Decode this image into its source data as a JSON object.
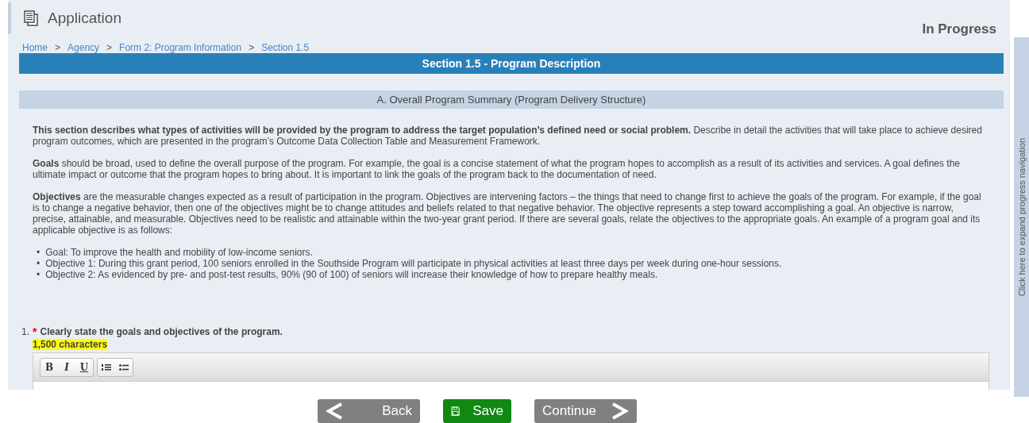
{
  "header": {
    "title": "Application",
    "status": "In Progress"
  },
  "breadcrumbs": [
    "Home",
    "Agency",
    "Form 2: Program Information",
    "Section 1.5"
  ],
  "breadcrumb_separator": ">",
  "section_title": "Section 1.5 - Program Description",
  "subsection_title": "A. Overall Program Summary (Program Delivery Structure)",
  "paragraphs": [
    "**This section describes what types of activities will be provided by the program to address the target population’s defined need or social problem.** Describe in detail the activities that will take place to achieve desired program outcomes, which are presented in the program’s Outcome Data Collection Table and Measurement Framework.",
    "**Goals** should be broad, used to define the overall purpose of the program. For example, the goal is a concise statement of what the program hopes to accomplish as a result of its activities and services. A goal defines the ultimate impact or outcome that the program hopes to bring about. It is important to link the goals of the program back to the documentation of need.",
    "**Objectives** are the measurable changes expected as a result of participation in the program. Objectives are intervening factors – the things that need to change first to achieve the goals of the program. For example, if the goal is to change a negative behavior, then one of the objectives might be to change attitudes and beliefs related to that negative behavior. The objective represents a step toward accomplishing a goal. An objective is narrow, precise, attainable, and measurable. Objectives need to be realistic and attainable within the two-year grant period. If there are several goals, relate the objectives to the appropriate goals. An example of a program goal and its applicable objective is as follows:"
  ],
  "bullet_marker": "•",
  "bullets": [
    "Goal: To improve the health and mobility of low-income seniors.",
    "Objective 1: During this grant period, 100 seniors enrolled in the Southside Program will participate in physical activities at least three days per week during one-hour sessions.",
    "Objective 2: As evidenced by pre- and post-test results, 90% (90 of 100) of seniors will increase their knowledge of how to prepare healthy meals."
  ],
  "question": {
    "number": "1.",
    "required": true,
    "required_mark": "*",
    "text": "Clearly state the goals and objectives of the program.",
    "limit": "1,500 characters"
  },
  "editor_toolbar": [
    {
      "kind": "bold",
      "label": "B"
    },
    {
      "kind": "italic",
      "label": "I"
    },
    {
      "kind": "underline",
      "label": "U"
    },
    {
      "kind": "numbered-list"
    },
    {
      "kind": "bulleted-list"
    }
  ],
  "buttons": [
    {
      "kind": "back",
      "label": "Back"
    },
    {
      "kind": "save",
      "label": "Save"
    },
    {
      "kind": "continue",
      "label": "Continue"
    }
  ],
  "side_nav": {
    "text": "Click here to expand progress navigation"
  }
}
